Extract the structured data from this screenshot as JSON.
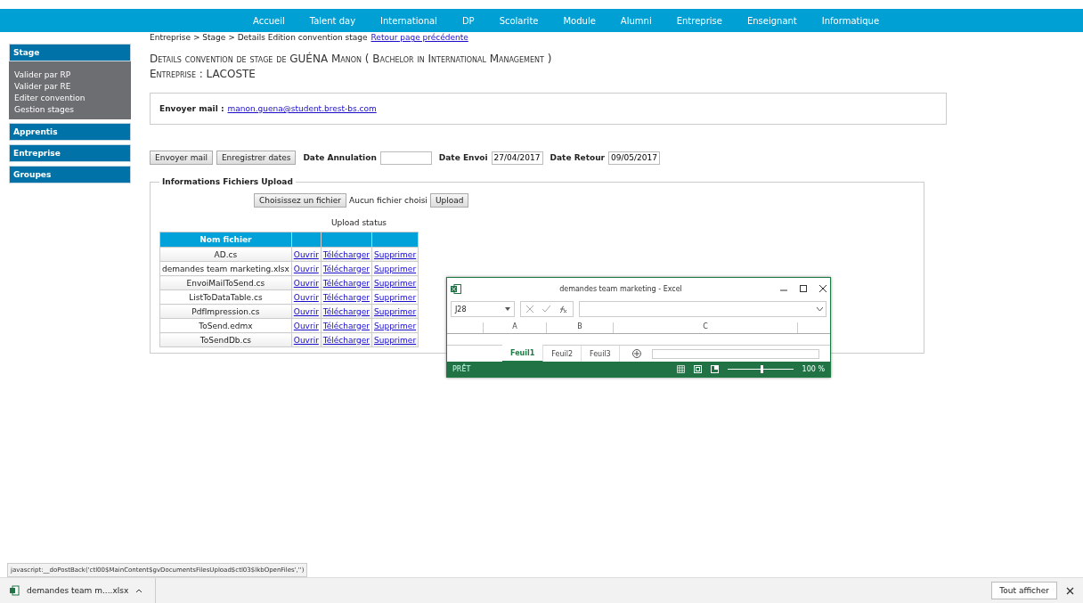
{
  "top_nav": {
    "items": [
      {
        "label": "Accueil"
      },
      {
        "label": "Talent day"
      },
      {
        "label": "International"
      },
      {
        "label": "DP"
      },
      {
        "label": "Scolarite"
      },
      {
        "label": "Module"
      },
      {
        "label": "Alumni"
      },
      {
        "label": "Entreprise"
      },
      {
        "label": "Enseignant"
      },
      {
        "label": "Informatique"
      }
    ]
  },
  "sidebar": {
    "sections": [
      {
        "label": "Stage",
        "expanded": true,
        "items": [
          "Valider par RP",
          "Valider par RE",
          "Editer convention",
          "Gestion stages"
        ]
      },
      {
        "label": "Apprentis",
        "expanded": false
      },
      {
        "label": "Entreprise",
        "expanded": false
      },
      {
        "label": "Groupes",
        "expanded": false
      }
    ]
  },
  "breadcrumb": {
    "path": "Entreprise > Stage > Details Edition convention stage",
    "back_link": "Retour page précédente"
  },
  "heading": {
    "title": "Details convention de stage de GUÉNA Manon ( Bachelor in International Management )",
    "company": "Entreprise : LACOSTE"
  },
  "mail_box": {
    "label": "Envoyer mail :",
    "email": "manon.guena@student.brest-bs.com"
  },
  "actions": {
    "buttons": [
      "Envoyer mail",
      "Enregistrer dates"
    ],
    "fields": [
      {
        "label": "Date Annulation"
      },
      {
        "label": "Date Envoi",
        "value": "27/04/2017"
      },
      {
        "label": "Date Retour",
        "value": "09/05/2017"
      }
    ]
  },
  "upload": {
    "legend": "Informations Fichiers Upload",
    "choose_button": "Choisissez un fichier",
    "no_file": "Aucun fichier choisi",
    "upload_button": "Upload",
    "status": "Upload status",
    "table": {
      "columns": [
        "Nom fichier"
      ],
      "rows": [
        {
          "name": "AD.cs",
          "actions": [
            "Ouvrir",
            "Télécharger",
            "Supprimer"
          ]
        },
        {
          "name": "demandes team marketing.xlsx",
          "actions": [
            "Ouvrir",
            "Télécharger",
            "Supprimer"
          ]
        },
        {
          "name": "EnvoiMailToSend.cs",
          "actions": [
            "Ouvrir",
            "Télécharger",
            "Supprimer"
          ]
        },
        {
          "name": "ListToDataTable.cs",
          "actions": [
            "Ouvrir",
            "Télécharger",
            "Supprimer"
          ]
        },
        {
          "name": "PdfImpression.cs",
          "actions": [
            "Ouvrir",
            "Télécharger",
            "Supprimer"
          ]
        },
        {
          "name": "ToSend.edmx",
          "actions": [
            "Ouvrir",
            "Télécharger",
            "Supprimer"
          ]
        },
        {
          "name": "ToSendDb.cs",
          "actions": [
            "Ouvrir",
            "Télécharger",
            "Supprimer"
          ]
        }
      ]
    }
  },
  "excel_window": {
    "title": "demandes team marketing - Excel",
    "name_box": "J28",
    "columns": [
      "A",
      "B",
      "C"
    ],
    "sheets": [
      {
        "label": "Feuil1",
        "selected": true
      },
      {
        "label": "Feuil2",
        "selected": false
      },
      {
        "label": "Feuil3",
        "selected": false
      }
    ],
    "status": "PRÊT",
    "zoom": {
      "level": 0.5,
      "reading": "100 %"
    }
  },
  "status_url": "javascript:__doPostBack('ctl00$MainContent$gvDocumentsFilesUpload$ctl03$lkbOpenFiles','')",
  "download_bar": {
    "file": "demandes team m....xlsx",
    "show_all": "Tout afficher"
  }
}
